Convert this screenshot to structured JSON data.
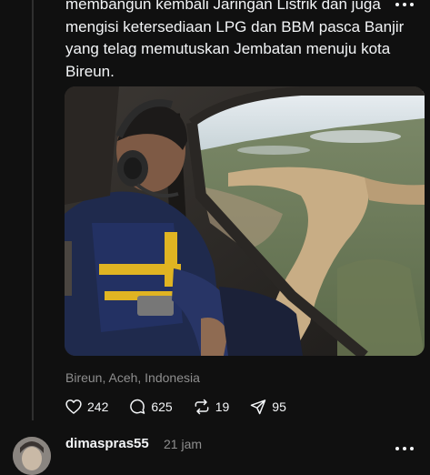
{
  "post": {
    "text_lines": [
      "membangun kembali Jaringan Listrik dan juga",
      "mengisi ketersediaan LPG dan BBM pasca Banjir",
      "yang telag memutuskan Jembatan menuju kota",
      "Bireun."
    ],
    "location": "Bireun, Aceh, Indonesia",
    "image_icon": "photo-helicopter-flood-view"
  },
  "actions": {
    "likes": {
      "icon": "heart-icon",
      "count": "242"
    },
    "comments": {
      "icon": "comment-icon",
      "count": "625"
    },
    "reposts": {
      "icon": "repost-icon",
      "count": "19"
    },
    "shares": {
      "icon": "share-icon",
      "count": "95"
    }
  },
  "reply": {
    "username": "dimaspras55",
    "time": "21 jam"
  },
  "colors": {
    "background": "#101010",
    "text": "#f3f5f7",
    "muted": "#8e8e8e",
    "thread_line": "#2f2f2f"
  }
}
